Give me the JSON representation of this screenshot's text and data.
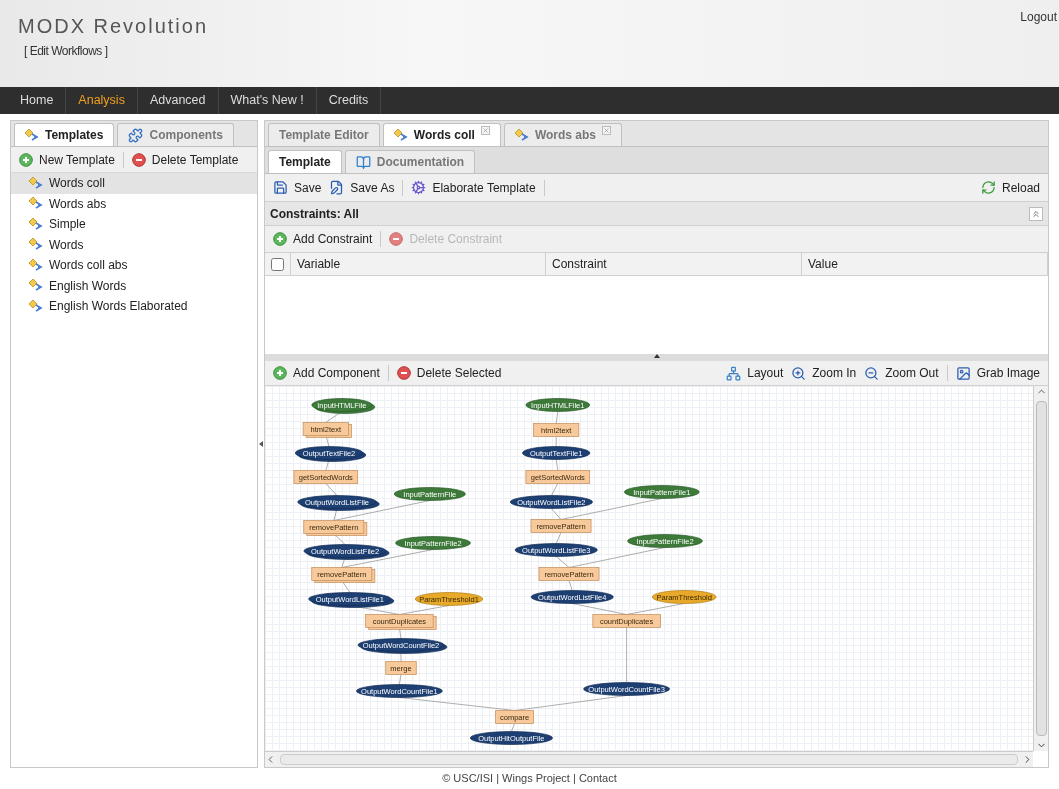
{
  "header": {
    "title": "MODX Revolution",
    "subtitle": "[ Edit Workflows ]",
    "logout": "Logout"
  },
  "nav": [
    {
      "label": "Home",
      "selected": false
    },
    {
      "label": "Analysis",
      "selected": true
    },
    {
      "label": "Advanced",
      "selected": false
    },
    {
      "label": "What's New !",
      "selected": false
    },
    {
      "label": "Credits",
      "selected": false
    }
  ],
  "left_panel": {
    "tabs": [
      {
        "label": "Templates",
        "kind": "templates",
        "selected": true
      },
      {
        "label": "Components",
        "kind": "components",
        "selected": false
      }
    ],
    "toolbar": [
      {
        "label": "New Template",
        "kind": "add"
      },
      {
        "label": "Delete Template",
        "kind": "delete"
      }
    ],
    "templates": [
      {
        "label": "Words coll",
        "selected": true
      },
      {
        "label": "Words abs",
        "selected": false
      },
      {
        "label": "Simple",
        "selected": false
      },
      {
        "label": "Words",
        "selected": false
      },
      {
        "label": "Words coll abs",
        "selected": false
      },
      {
        "label": "English Words",
        "selected": false
      },
      {
        "label": "English Words Elaborated",
        "selected": false
      }
    ]
  },
  "editor": {
    "tabs": [
      {
        "label": "Template Editor",
        "kind": "plain",
        "selected": false,
        "closable": false
      },
      {
        "label": "Words coll",
        "kind": "template",
        "selected": true,
        "closable": true
      },
      {
        "label": "Words abs",
        "kind": "template",
        "selected": false,
        "closable": true
      }
    ],
    "subtabs": [
      {
        "label": "Template",
        "kind": "plain",
        "selected": true
      },
      {
        "label": "Documentation",
        "kind": "doc",
        "selected": false
      }
    ],
    "toolbar": [
      {
        "label": "Save",
        "kind": "save"
      },
      {
        "label": "Save As",
        "kind": "saveas"
      },
      {
        "label": "Elaborate Template",
        "kind": "gear"
      }
    ],
    "reload": "Reload",
    "constraints": {
      "title": "Constraints: All",
      "toolbar": [
        {
          "label": "Add Constraint",
          "kind": "add",
          "disabled": false
        },
        {
          "label": "Delete Constraint",
          "kind": "delete",
          "disabled": true
        }
      ],
      "select_all_checked": false,
      "columns": [
        "Variable",
        "Constraint",
        "Value"
      ]
    },
    "canvas_toolbar": {
      "left": [
        {
          "label": "Add Component",
          "kind": "add"
        },
        {
          "label": "Delete Selected",
          "kind": "delete"
        }
      ],
      "right": [
        {
          "label": "Layout",
          "kind": "layout"
        },
        {
          "label": "Zoom In",
          "kind": "zoomin"
        },
        {
          "label": "Zoom Out",
          "kind": "zoomout"
        },
        {
          "label": "Grab Image",
          "kind": "image"
        }
      ]
    },
    "workflow": {
      "nodes": [
        {
          "label": "InputHTMLFile",
          "kind": "input",
          "stacked": true
        },
        {
          "label": "html2text",
          "kind": "component",
          "stacked": true
        },
        {
          "label": "OutputTextFile2",
          "kind": "output",
          "stacked": true
        },
        {
          "label": "getSortedWords",
          "kind": "component",
          "stacked": false
        },
        {
          "label": "OutputWordListFile",
          "kind": "output",
          "stacked": true
        },
        {
          "label": "InputPatternFile",
          "kind": "input",
          "stacked": false
        },
        {
          "label": "removePattern",
          "kind": "component",
          "stacked": true
        },
        {
          "label": "OutputWordListFile2",
          "kind": "output",
          "stacked": true
        },
        {
          "label": "InputPatternFile2",
          "kind": "input",
          "stacked": false
        },
        {
          "label": "removePattern",
          "kind": "component",
          "stacked": true
        },
        {
          "label": "OutputWordListFile1",
          "kind": "output",
          "stacked": true
        },
        {
          "label": "ParamThreshold1",
          "kind": "param",
          "stacked": false
        },
        {
          "label": "countDuplicates",
          "kind": "component",
          "stacked": true
        },
        {
          "label": "OutputWordCountFile2",
          "kind": "output",
          "stacked": true
        },
        {
          "label": "merge",
          "kind": "component",
          "stacked": false
        },
        {
          "label": "OutputWordCountFile1",
          "kind": "output",
          "stacked": false
        },
        {
          "label": "compare",
          "kind": "component",
          "stacked": false
        },
        {
          "label": "OutputHitOutputFile",
          "kind": "output",
          "stacked": false
        },
        {
          "label": "InputHTMLFile1",
          "kind": "input",
          "stacked": false
        },
        {
          "label": "html2text",
          "kind": "component",
          "stacked": false
        },
        {
          "label": "OutputTextFile1",
          "kind": "output",
          "stacked": false
        },
        {
          "label": "getSortedWords",
          "kind": "component",
          "stacked": false
        },
        {
          "label": "OutputWordListFile2",
          "kind": "output",
          "stacked": false
        },
        {
          "label": "InputPatternFile1",
          "kind": "input",
          "stacked": false
        },
        {
          "label": "removePattern",
          "kind": "component",
          "stacked": false
        },
        {
          "label": "OutputWordListFile3",
          "kind": "output",
          "stacked": false
        },
        {
          "label": "InputPatternFile2",
          "kind": "input",
          "stacked": false
        },
        {
          "label": "removePattern",
          "kind": "component",
          "stacked": false
        },
        {
          "label": "OutputWordListFile4",
          "kind": "output",
          "stacked": false
        },
        {
          "label": "ParamThreshold",
          "kind": "param",
          "stacked": false
        },
        {
          "label": "countDuplicates",
          "kind": "component",
          "stacked": false
        },
        {
          "label": "OutputWordCountFile3",
          "kind": "output",
          "stacked": false
        }
      ]
    }
  },
  "footer": "© USC/ISI | Wings Project | Contact"
}
